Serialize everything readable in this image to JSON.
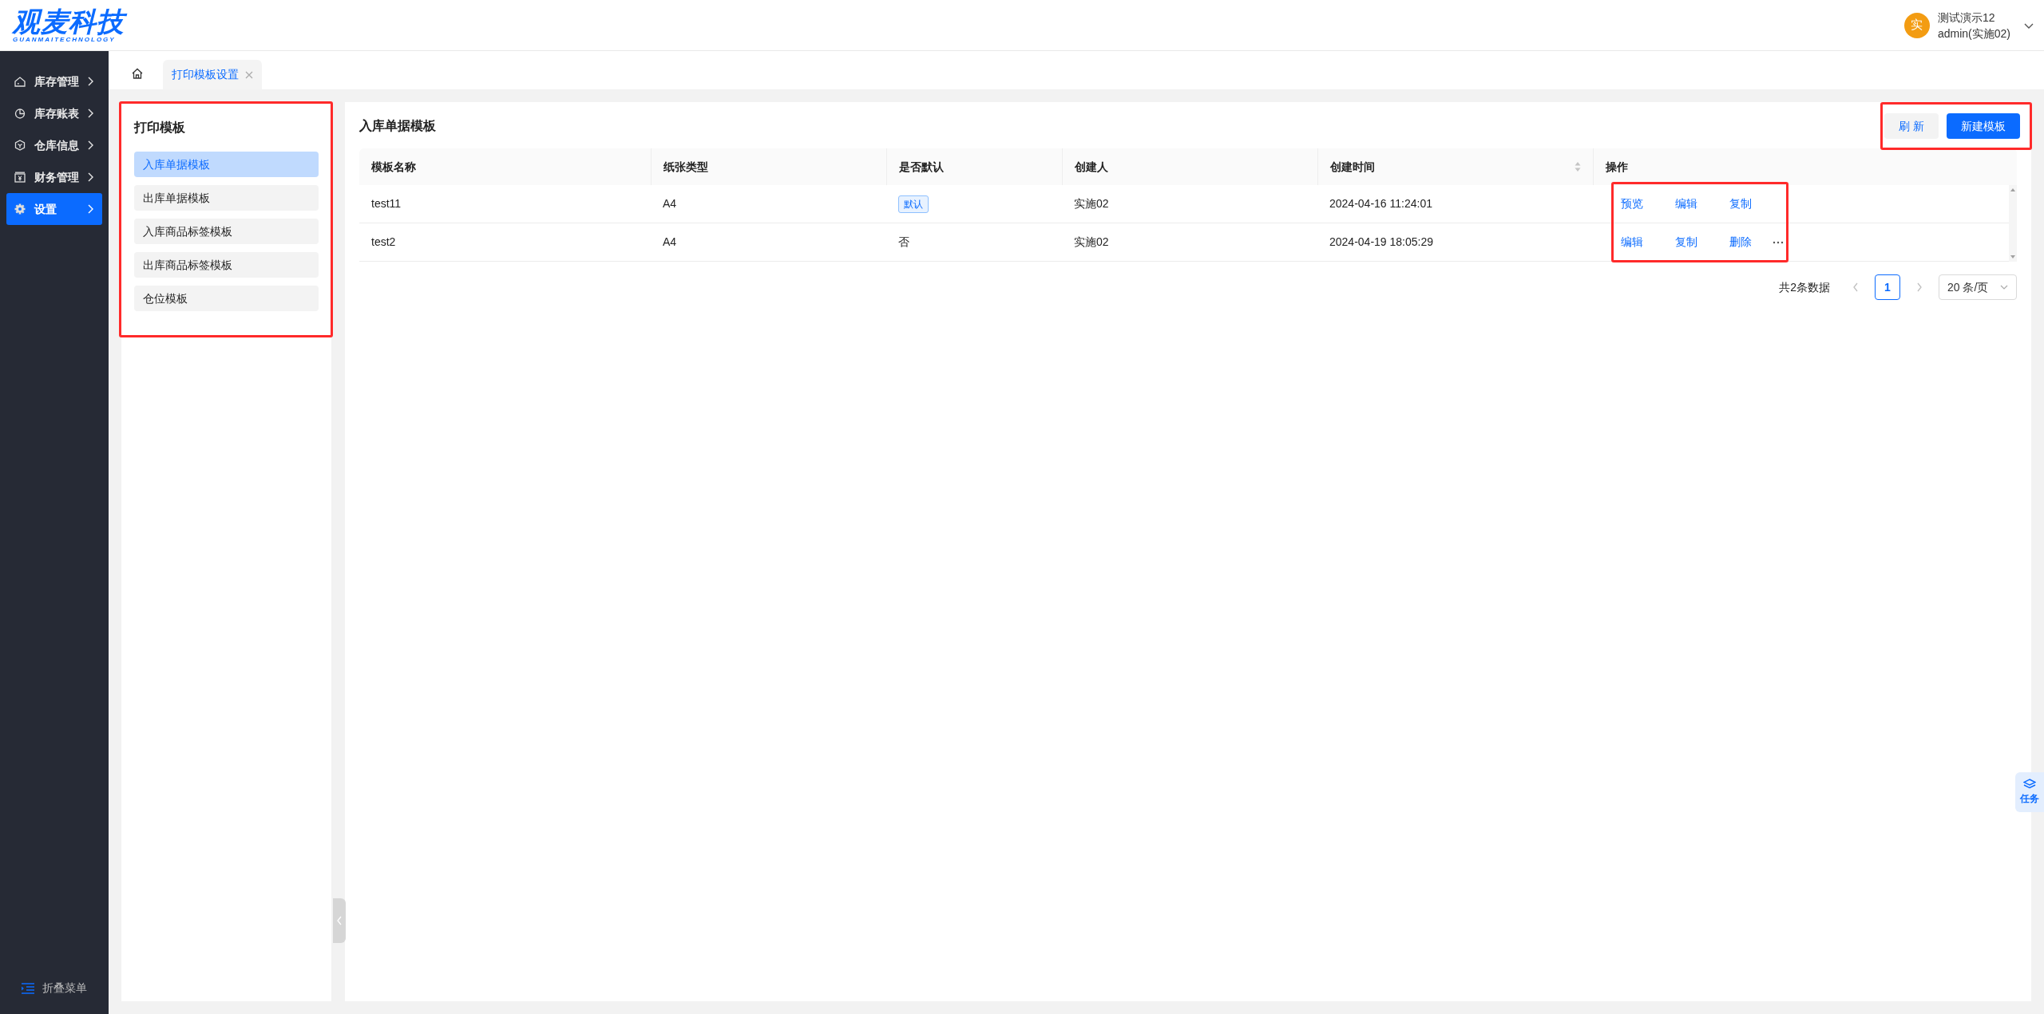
{
  "header": {
    "logo": {
      "title": "观麦科技",
      "subtitle": "GUANMAITECHNOLOGY"
    },
    "user": {
      "avatar": "实",
      "name": "测试演示12",
      "account": "admin(实施02)"
    }
  },
  "sidebar": {
    "items": [
      {
        "label": "库存管理",
        "kind": "warehouse",
        "selected": false
      },
      {
        "label": "库存账表",
        "kind": "chart",
        "selected": false
      },
      {
        "label": "仓库信息",
        "kind": "package",
        "selected": false
      },
      {
        "label": "财务管理",
        "kind": "finance",
        "selected": false
      },
      {
        "label": "设置",
        "kind": "settings",
        "selected": true
      }
    ],
    "collapse": "折叠菜单"
  },
  "tabs": [
    {
      "label": "打印模板设置",
      "selected": true
    }
  ],
  "template_panel": {
    "title": "打印模板",
    "items": [
      {
        "label": "入库单据模板",
        "selected": true
      },
      {
        "label": "出库单据模板",
        "selected": false
      },
      {
        "label": "入库商品标签模板",
        "selected": false
      },
      {
        "label": "出库商品标签模板",
        "selected": false
      },
      {
        "label": "仓位模板",
        "selected": false
      }
    ]
  },
  "main": {
    "title": "入库单据模板",
    "buttons": [
      {
        "label": "刷 新",
        "kind": "secondary"
      },
      {
        "label": "新建模板",
        "kind": "primary"
      }
    ],
    "table": {
      "columns": [
        "模板名称",
        "纸张类型",
        "是否默认",
        "创建人",
        "创建时间",
        "操作"
      ],
      "rows": [
        {
          "name": "test11",
          "paper": "A4",
          "default": {
            "kind": "tag",
            "text": "默认"
          },
          "creator": "实施02",
          "created": "2024-04-16 11:24:01",
          "actions": [
            "预览",
            "编辑",
            "复制"
          ],
          "more": false
        },
        {
          "name": "test2",
          "paper": "A4",
          "default": {
            "kind": "text",
            "text": "否"
          },
          "creator": "实施02",
          "created": "2024-04-19 18:05:29",
          "actions": [
            "编辑",
            "复制",
            "删除"
          ],
          "more": true
        }
      ]
    },
    "pagination": {
      "total": "共2条数据",
      "pages": [
        {
          "label": "1",
          "selected": true
        }
      ],
      "page_size": "20 条/页"
    }
  },
  "task_button": "任务"
}
